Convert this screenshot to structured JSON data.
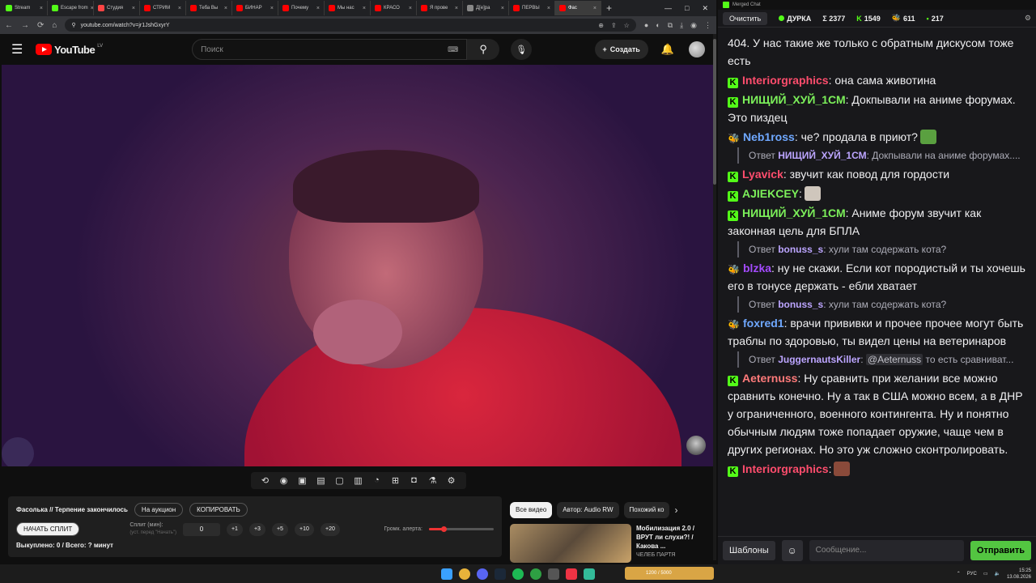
{
  "browser": {
    "tabs": [
      {
        "label": "Stream",
        "color": "#53fc18"
      },
      {
        "label": "Escape from",
        "color": "#53fc18"
      },
      {
        "label": "Студия",
        "color": "#ff4444"
      },
      {
        "label": "СТРИМ",
        "color": "#ff0000"
      },
      {
        "label": "Теба Вы",
        "color": "#ff0000"
      },
      {
        "label": "БИНАР",
        "color": "#ff0000"
      },
      {
        "label": "Почему",
        "color": "#ff0000"
      },
      {
        "label": "Мы нас",
        "color": "#ff0000"
      },
      {
        "label": "КРАСО",
        "color": "#ff0000"
      },
      {
        "label": "Я прове",
        "color": "#ff0000"
      },
      {
        "label": "Д[е]ра",
        "color": "#888888"
      },
      {
        "label": "ПЕРВЫ",
        "color": "#ff0000"
      },
      {
        "label": "Фас",
        "color": "#ff0000",
        "active": true
      }
    ],
    "url": "youtube.com/watch?v=jr1JshGxyrY"
  },
  "youtube": {
    "logo_text": "YouTube",
    "country": "LV",
    "search_placeholder": "Поиск",
    "create_label": "Создать"
  },
  "panel": {
    "title": "Фасолька // Терпение закончилось",
    "auction_btn": "На аукцион",
    "copy_btn": "КОПИРОВАТЬ",
    "start_split_btn": "НАЧАТЬ СПЛИТ",
    "split_label": "Сплит (мин):",
    "split_hint": "(уст. перед \"Начать\")",
    "split_value": "0",
    "increments": [
      "+1",
      "+3",
      "+5",
      "+10",
      "+20"
    ],
    "volume_label": "Громк. алерта:",
    "volume_level": 0.22,
    "bought_text": "Выкуплено: 0 / Всего: ? минут"
  },
  "reco": {
    "chips": [
      "Все видео",
      "Автор: Audio RW",
      "Похожий ко"
    ],
    "title": "Мобилизация 2.0 / ВРУТ ли слухи?! / Какова ...",
    "channel": "ЧЕЛЕБ ПАРТЯ"
  },
  "chat": {
    "window_title": "Merged Chat",
    "clear_btn": "Очистить",
    "stream_name": "ДУРКА",
    "stat_total": "Σ 2377",
    "stat_kick": "1549",
    "stat_bee": "611",
    "stat_other": "217",
    "input_placeholder": "Сообщение...",
    "templates_btn": "Шаблоны",
    "send_btn": "Отправить",
    "messages": [
      {
        "type": "text",
        "text": "404. У нас такие же только с обратным дискусом тоже есть"
      },
      {
        "type": "msg",
        "badge": "K",
        "nick": "Interiorgraphics",
        "color": "#ff4d6d",
        "text": ": она сама животина"
      },
      {
        "type": "msg",
        "badge": "K",
        "nick": "НИЩИЙ_ХУЙ_1СМ",
        "color": "#7cf05a",
        "text": ": Докпывали на аниме форумах. Это пиздец"
      },
      {
        "type": "msg",
        "badge": "bee",
        "nick": "Neb1ross",
        "color": "#6fa8ff",
        "text": ": че? продала в приют?",
        "emote": "#5aa040"
      },
      {
        "type": "reply",
        "prefix": "Ответ",
        "nick": "НИЩИЙ_ХУЙ_1СМ",
        "text": ": Докпывали на аниме форумах...."
      },
      {
        "type": "msg",
        "badge": "K",
        "nick": "Lyavick",
        "color": "#ff4d6d",
        "text": ": звучит как повод для гордости"
      },
      {
        "type": "msg",
        "badge": "K",
        "nick": "AJIEKCEY",
        "color": "#7cf05a",
        "text": ":",
        "emote": "#cfc6bc"
      },
      {
        "type": "msg",
        "badge": "K",
        "nick": "НИЩИЙ_ХУЙ_1СМ",
        "color": "#7cf05a",
        "text": ": Аниме форум звучит как законная цель для БПЛА"
      },
      {
        "type": "reply",
        "prefix": "Ответ",
        "nick": "bonuss_s",
        "text": ": хули там содержать кота?"
      },
      {
        "type": "msg",
        "badge": "bee",
        "nick": "blzka",
        "color": "#a44bff",
        "text": ": ну не скажи. Если кот породистый и ты хочешь его в тонусе держать - ебли хватает"
      },
      {
        "type": "reply",
        "prefix": "Ответ",
        "nick": "bonuss_s",
        "text": ": хули там содержать кота?"
      },
      {
        "type": "msg",
        "badge": "bee",
        "nick": "foxred1",
        "color": "#6fa8ff",
        "text": ": врачи прививки и прочее прочее могут быть траблы по здоровью, ты видел цены на ветеринаров"
      },
      {
        "type": "reply",
        "prefix": "Ответ",
        "nick": "JuggernautsKiller",
        "text": ":",
        "mention": "@Aeternuss",
        "tail": " то есть сравниват..."
      },
      {
        "type": "msg",
        "badge": "K",
        "nick": "Aeternuss",
        "color": "#ff7a7a",
        "text": ": Ну сравнить при желании все можно сравнить конечно. Ну а так в США можно всем, а в ДНР у ограниченного, военного контингента. Ну и понятно обычным людям тоже попадает оружие, чаще чем в других регионах. Но это уж сложно сконтролировать."
      },
      {
        "type": "msg",
        "badge": "K",
        "nick": "Interiorgraphics",
        "color": "#ff4d6d",
        "text": ":",
        "emote": "#8a4a3a"
      }
    ]
  },
  "taskbar": {
    "party_text": "1200 / 5000",
    "lang": "РУС",
    "time": "15:25",
    "date": "13.08.2026"
  }
}
